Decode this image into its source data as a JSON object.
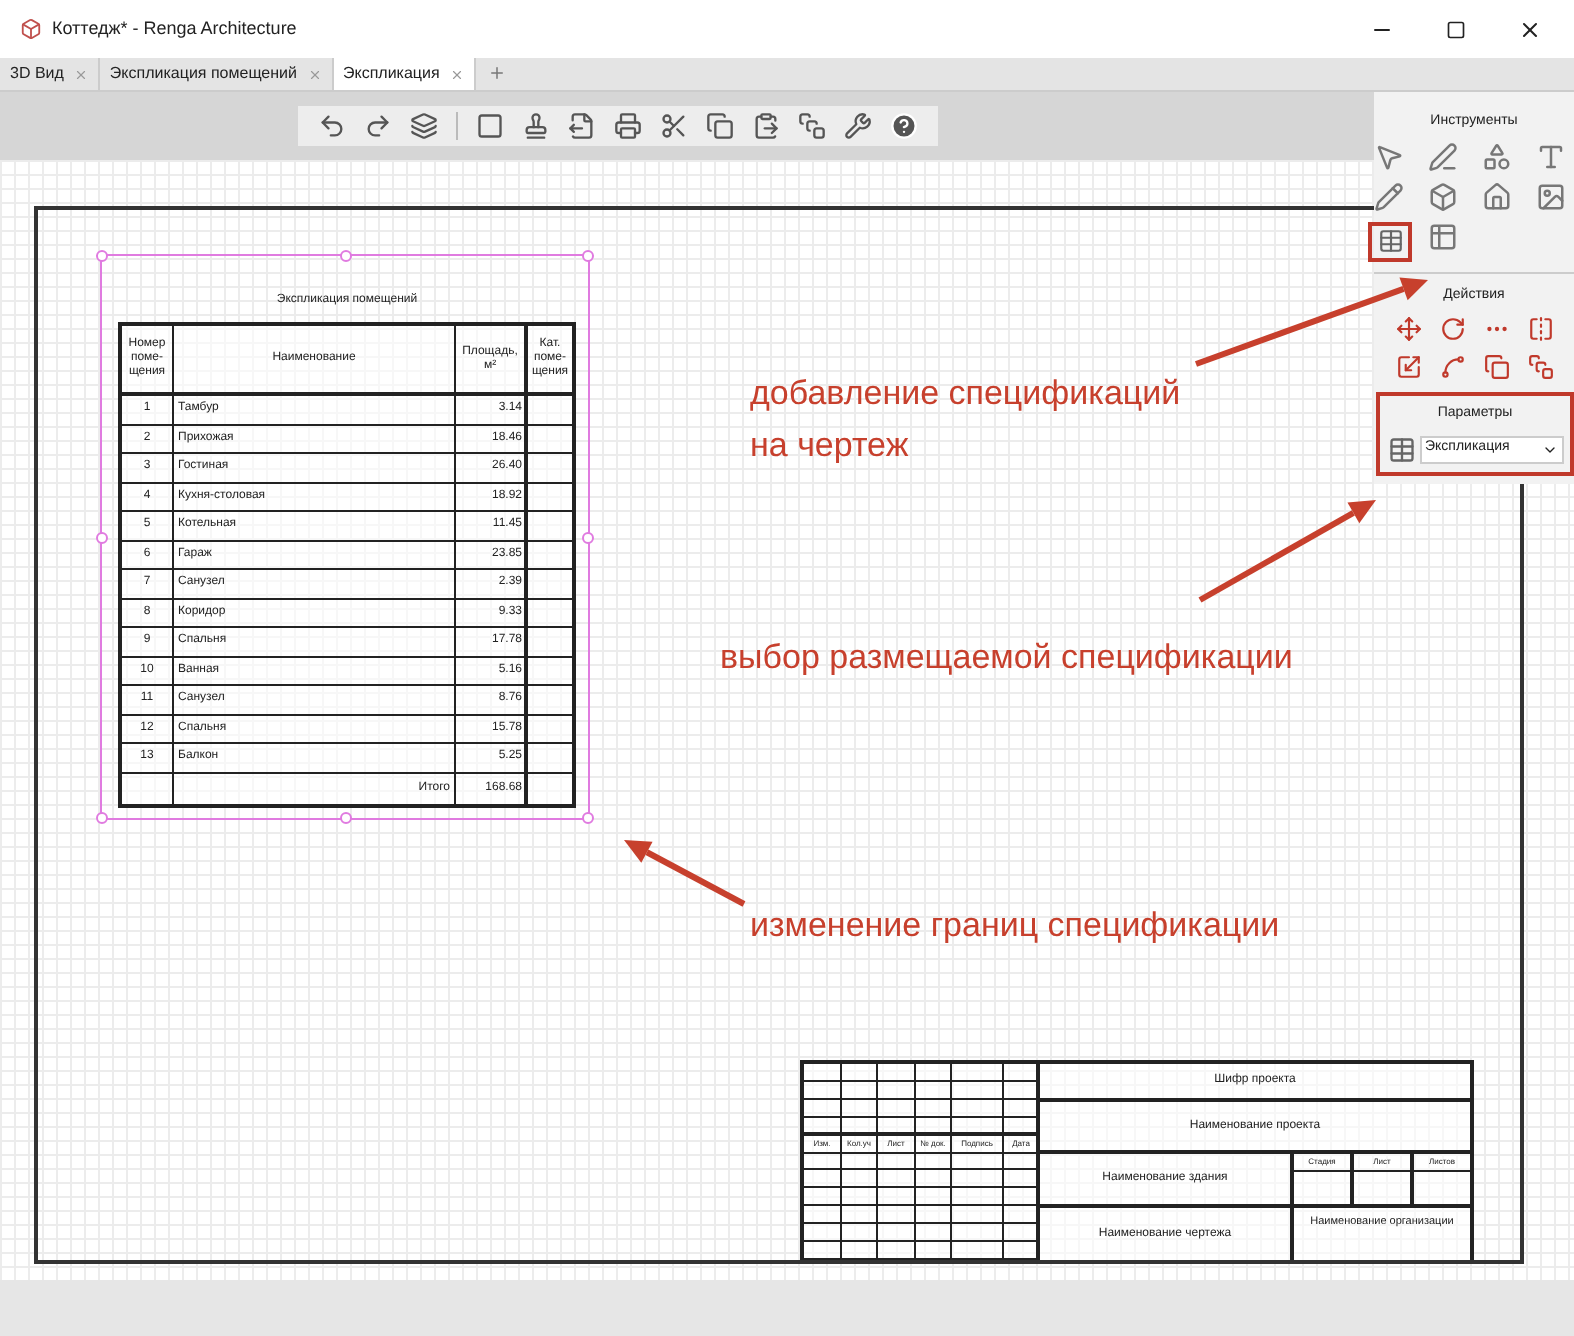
{
  "window": {
    "title": "Коттедж* - Renga Architecture"
  },
  "tabs": [
    {
      "label": "3D Вид",
      "selected": false
    },
    {
      "label": "Экспликация помещений",
      "selected": false
    },
    {
      "label": "Экспликация",
      "selected": true
    }
  ],
  "tools_panel": {
    "title": "Инструменты"
  },
  "actions_panel": {
    "title": "Действия"
  },
  "parameters_panel": {
    "title": "Параметры",
    "dropdown_value": "Экспликация"
  },
  "schedule": {
    "title": "Экспликация помещений",
    "columns": [
      "Номер поме-щения",
      "Наименование",
      "Площадь, м²",
      "Кат. поме-щения"
    ],
    "rows": [
      {
        "number": "1",
        "name": "Тамбур",
        "area": "3.14"
      },
      {
        "number": "2",
        "name": "Прихожая",
        "area": "18.46"
      },
      {
        "number": "3",
        "name": "Гостиная",
        "area": "26.40"
      },
      {
        "number": "4",
        "name": "Кухня-столовая",
        "area": "18.92"
      },
      {
        "number": "5",
        "name": "Котельная",
        "area": "11.45"
      },
      {
        "number": "6",
        "name": "Гараж",
        "area": "23.85"
      },
      {
        "number": "7",
        "name": "Санузел",
        "area": "2.39"
      },
      {
        "number": "8",
        "name": "Коридор",
        "area": "9.33"
      },
      {
        "number": "9",
        "name": "Спальня",
        "area": "17.78"
      },
      {
        "number": "10",
        "name": "Ванная",
        "area": "5.16"
      },
      {
        "number": "11",
        "name": "Санузел",
        "area": "8.76"
      },
      {
        "number": "12",
        "name": "Спальня",
        "area": "15.78"
      },
      {
        "number": "13",
        "name": "Балкон",
        "area": "5.25"
      }
    ],
    "total": {
      "label": "Итого",
      "area": "168.68"
    }
  },
  "title_block": {
    "revision_headers": [
      "Изм.",
      "Кол.уч",
      "Лист",
      "№ док.",
      "Подпись",
      "Дата"
    ],
    "project_code": "Шифр проекта",
    "project_name": "Наименование проекта",
    "building_name": "Наименование здания",
    "stage_headers": [
      "Стадия",
      "Лист",
      "Листов"
    ],
    "drawing_name": "Наименование чертежа",
    "organization": "Наименование организации"
  },
  "annotations": [
    {
      "text": "добавление спецификаций на чертеж"
    },
    {
      "text": "выбор размещаемой спецификации"
    },
    {
      "text": "изменение границ спецификации"
    }
  ]
}
